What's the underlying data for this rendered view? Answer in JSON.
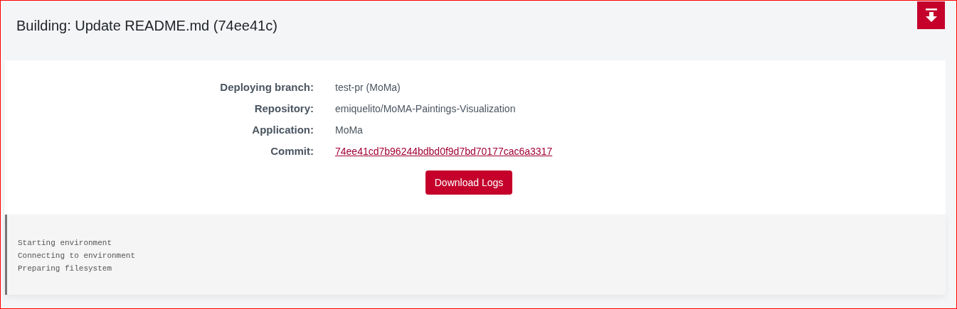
{
  "header": {
    "title": "Building: Update README.md (74ee41c)"
  },
  "details": [
    {
      "label": "Deploying branch:",
      "value": "test-pr (MoMa)",
      "kind": "text"
    },
    {
      "label": "Repository:",
      "value": "emiquelito/MoMA-Paintings-Visualization",
      "kind": "text"
    },
    {
      "label": "Application:",
      "value": "MoMa",
      "kind": "text"
    },
    {
      "label": "Commit:",
      "value": "74ee41cd7b96244bdbd0f9d7bd70177cac6a3317",
      "kind": "link"
    }
  ],
  "download_button": {
    "label": "Download Logs"
  },
  "log": [
    "Starting environment",
    "Connecting to environment",
    "Preparing filesystem"
  ]
}
